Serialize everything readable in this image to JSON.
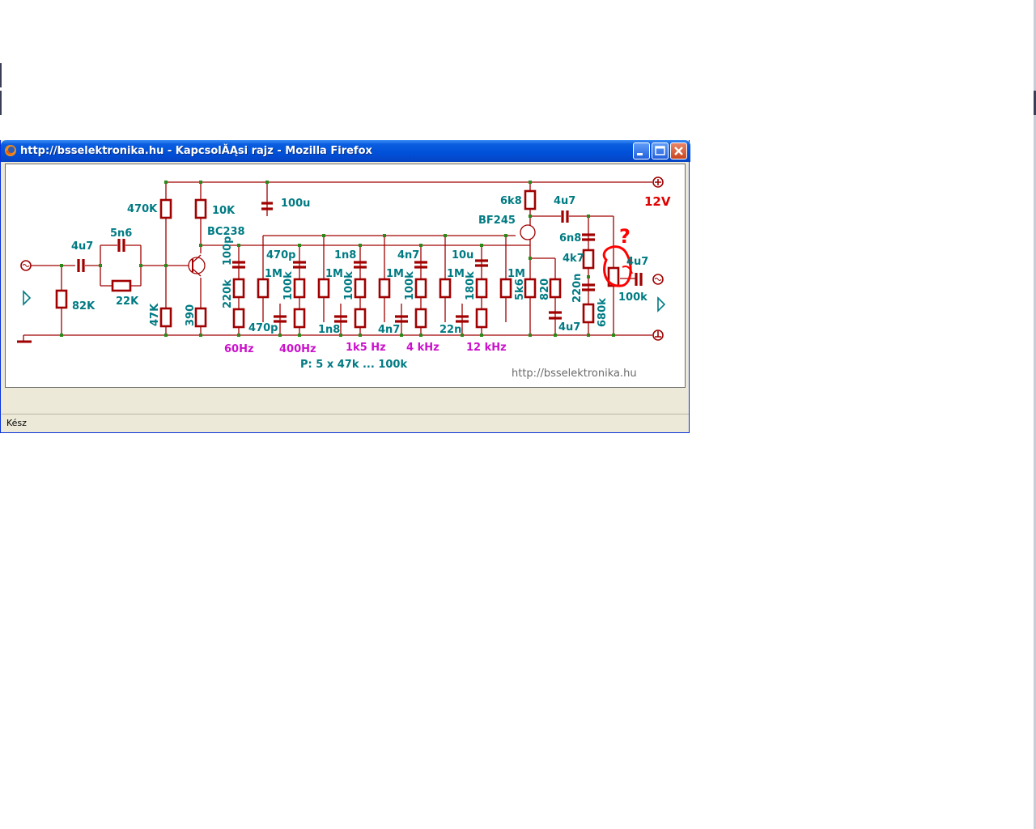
{
  "window": {
    "title": "http://bsselektronika.hu - KapcsolĂĄsi rajz - Mozilla Firefox",
    "status": "Kész"
  },
  "schematic": {
    "supply_voltage": "12V",
    "question_mark": "?",
    "watermark": "http://bsselektronika.hu",
    "pot_note": "P: 5 x 47k ... 100k",
    "input_section": {
      "c_in": "4u7",
      "r_in": "82K",
      "c_par": "5n6",
      "r_par": "22K",
      "r_bias_top": "470K",
      "r_bias_bot": "47K",
      "r_collector": "10K",
      "r_emitter": "390",
      "transistor": "BC238",
      "c_supply": "100u"
    },
    "bands": [
      {
        "freq": "60Hz",
        "c_top": "100p",
        "r_left": "220k",
        "r_feed": "1M",
        "c_bottom": "470p"
      },
      {
        "freq": "400Hz",
        "c_top": "470p",
        "r_left": "100k",
        "r_feed": "1M",
        "c_bottom": "1n8"
      },
      {
        "freq": "1k5 Hz",
        "c_top": "1n8",
        "r_left": "100k",
        "r_feed": "1M",
        "c_bottom": "4n7"
      },
      {
        "freq": "4 kHz",
        "c_top": "4n7",
        "r_left": "100k",
        "r_feed": "1M",
        "c_bottom": "22n"
      },
      {
        "freq": "12 kHz",
        "c_top": "10u",
        "r_left": "180k",
        "r_feed": "1M",
        "c_bottom": ""
      }
    ],
    "output_section": {
      "r_drain": "6k8",
      "fet": "BF245",
      "r_source": "5k6",
      "r_src2": "820",
      "c_src": "4u7",
      "c_coupling": "4u7",
      "c_6n8": "6n8",
      "r_4k7": "4k7",
      "c_220n": "220n",
      "r_680k": "680k",
      "pot_out": "100k",
      "c_out": "4u7"
    }
  }
}
